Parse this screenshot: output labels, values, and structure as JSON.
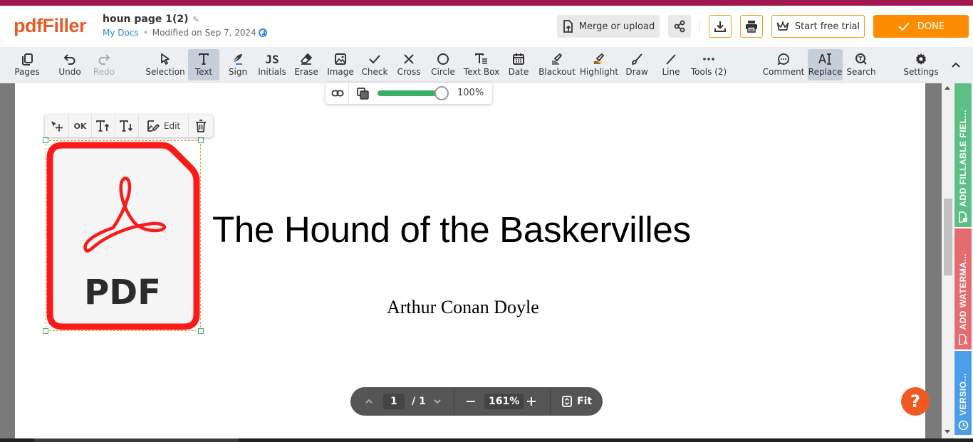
{
  "app": {
    "logo": "pdfFiller",
    "brand_color": "#e25c2a",
    "top_stripe_color": "#a0174f"
  },
  "document": {
    "title": "houn page 1(2)",
    "location_link": "My Docs",
    "modified": "Modified on Sep 7, 2024"
  },
  "header_actions": {
    "merge_label": "Merge or upload",
    "trial_label": "Start free trial",
    "done_label": "DONE",
    "done_color": "#ff8c00"
  },
  "toolbar": {
    "items": [
      {
        "label": "Pages",
        "icon": "pages-icon"
      },
      {
        "label": "Undo",
        "icon": "undo-icon"
      },
      {
        "label": "Redo",
        "icon": "redo-icon",
        "disabled": true
      },
      {
        "label": "Selection",
        "icon": "cursor-icon"
      },
      {
        "label": "Text",
        "icon": "text-icon",
        "active": true
      },
      {
        "label": "Sign",
        "icon": "sign-icon"
      },
      {
        "label": "Initials",
        "icon": "initials-icon"
      },
      {
        "label": "Erase",
        "icon": "eraser-icon"
      },
      {
        "label": "Image",
        "icon": "image-icon"
      },
      {
        "label": "Check",
        "icon": "check-icon"
      },
      {
        "label": "Cross",
        "icon": "cross-icon"
      },
      {
        "label": "Circle",
        "icon": "circle-icon"
      },
      {
        "label": "Text Box",
        "icon": "textbox-icon"
      },
      {
        "label": "Date",
        "icon": "calendar-icon"
      },
      {
        "label": "Blackout",
        "icon": "blackout-icon"
      },
      {
        "label": "Highlight",
        "icon": "highlight-icon"
      },
      {
        "label": "Draw",
        "icon": "brush-icon"
      },
      {
        "label": "Line",
        "icon": "line-icon"
      },
      {
        "label": "Tools (2)",
        "icon": "more-icon"
      },
      {
        "label": "Comment",
        "icon": "comment-icon"
      },
      {
        "label": "Replace",
        "icon": "replace-icon",
        "active": true
      },
      {
        "label": "Search",
        "icon": "search-icon"
      },
      {
        "label": "Settings",
        "icon": "gear-icon"
      }
    ]
  },
  "opacity_popup": {
    "value_label": "100%",
    "opacity_percent": 100
  },
  "image_toolbar": {
    "ok_label": "OK",
    "edit_label": "Edit"
  },
  "page_content": {
    "image_label": "PDF",
    "title": "The Hound of the Baskervilles",
    "author": "Arthur Conan Doyle"
  },
  "side_tabs": {
    "fillable": "ADD FILLABLE FIEL...",
    "watermark": "ADD WATERMA...",
    "version": "VERSIO..."
  },
  "navigation": {
    "current_page": "1",
    "total_pages": "/ 1",
    "zoom": "161%",
    "fit_label": "Fit"
  },
  "help": {
    "label": "?"
  }
}
